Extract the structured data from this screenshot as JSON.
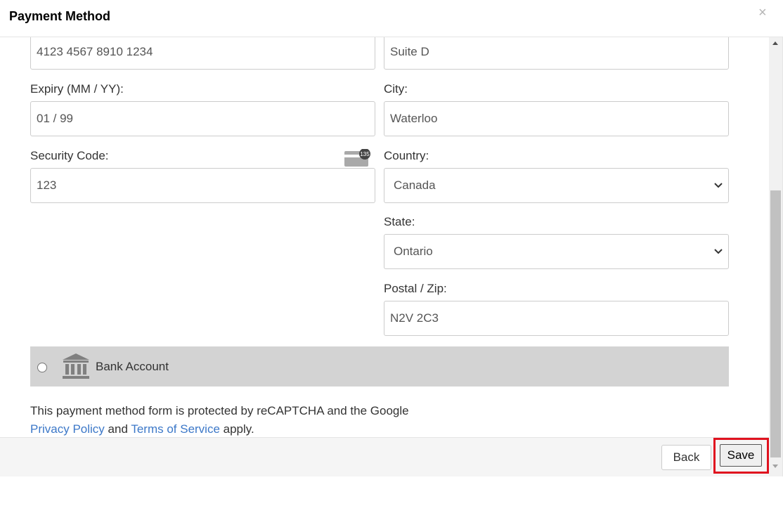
{
  "dialog": {
    "title": "Payment Method",
    "close_label": "×"
  },
  "card": {
    "number_value": "4123 4567 8910 1234",
    "expiry_label": "Expiry (MM / YY):",
    "expiry_value": "01 / 99",
    "security_label": "Security Code:",
    "security_value": "123",
    "security_icon_badge": "135"
  },
  "address": {
    "line2_value": "Suite D",
    "city_label": "City:",
    "city_value": "Waterloo",
    "country_label": "Country:",
    "country_value": "Canada",
    "state_label": "State:",
    "state_value": "Ontario",
    "postal_label": "Postal / Zip:",
    "postal_value": "N2V 2C3"
  },
  "bank": {
    "label": "Bank Account"
  },
  "notice": {
    "text_before": "This payment method form is protected by reCAPTCHA and the Google",
    "privacy_link": "Privacy Policy",
    "and_text": " and ",
    "terms_link": "Terms of Service",
    "after_text": " apply."
  },
  "footer": {
    "back_label": "Back",
    "save_label": "Save"
  },
  "colors": {
    "link": "#3c78c8",
    "highlight": "#e0121f",
    "bank_row_bg": "#d3d3d3"
  }
}
